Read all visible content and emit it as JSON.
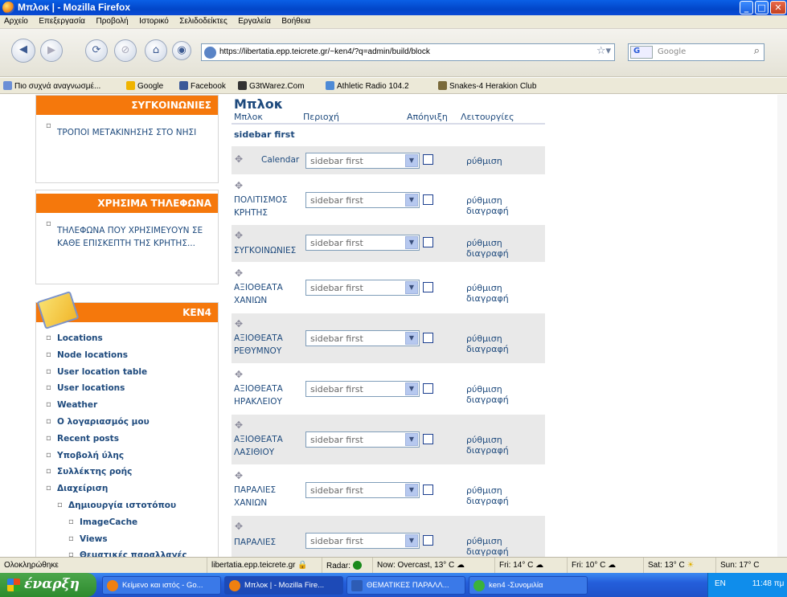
{
  "window": {
    "title": "Μπλοκ | - Mozilla Firefox"
  },
  "menu": [
    "Αρχείο",
    "Επεξεργασία",
    "Προβολή",
    "Ιστορικό",
    "Σελιδοδείκτες",
    "Εργαλεία",
    "Βοήθεια"
  ],
  "address": {
    "url": "https://libertatia.epp.teicrete.gr/~ken4/?q=admin/build/block"
  },
  "search": {
    "engine": "G",
    "placeholder": "Google"
  },
  "bookmarks": [
    "Πιο συχνά αναγνωσμέ...",
    "Google",
    "Facebook",
    "G3tWarez.Com",
    "Athletic Radio 104.2",
    "Snakes-4 Herakion Club"
  ],
  "sidebar": {
    "block1": {
      "title": "ΣΥΓΚΟΙΝΩΝΙΕΣ",
      "items": [
        "ΤΡΟΠΟΙ ΜΕΤΑΚΙΝΗΣΗΣ ΣΤΟ ΝΗΣΙ"
      ]
    },
    "block2": {
      "title": "ΧΡΗΣΙΜΑ ΤΗΛΕΦΩΝΑ",
      "items": [
        "ΤΗΛΕΦΩΝΑ ΠΟΥ ΧΡΗΣΙΜΕΥΟΥΝ ΣΕ ΚΑΘΕ ΕΠΙΣΚΕΠΤΗ ΤΗΣ ΚΡΗΤΗΣ..."
      ]
    },
    "block3": {
      "title": "KEN4",
      "items": [
        "Locations",
        "Node locations",
        "User location table",
        "User locations",
        "Weather",
        "Ο λογαριασμός μου",
        "Recent posts",
        "Υποβολή ύλης",
        "Συλλέκτης ροής",
        "Διαχείριση",
        "Δημιουργία ιστοτόπου",
        "ImageCache",
        "Views",
        "Θεματικές παραλλαγές"
      ]
    }
  },
  "main": {
    "title": "Μπλοκ",
    "headers": {
      "block": "Μπλοκ",
      "region": "Περιοχή",
      "throttle": "Απόηνιξη",
      "ops": "Λειτουργίες"
    },
    "region_label": "sidebar first",
    "rows": [
      {
        "name": "Calendar",
        "region": "sidebar first",
        "ops": "ρύθμιση"
      },
      {
        "name": "ΠΟΛΙΤΙΣΜΟΣ ΚΡΗΤΗΣ",
        "region": "sidebar first",
        "ops": "ρύθμιση διαγραφή"
      },
      {
        "name": "ΣΥΓΚΟΙΝΩΝΙΕΣ",
        "region": "sidebar first",
        "ops": "ρύθμιση διαγραφή"
      },
      {
        "name": "ΑΞΙΟΘΕΑΤΑ ΧΑΝΙΩΝ",
        "region": "sidebar first",
        "ops": "ρύθμιση διαγραφή"
      },
      {
        "name": "ΑΞΙΟΘΕΑΤΑ ΡΕΘΥΜΝΟΥ",
        "region": "sidebar first",
        "ops": "ρύθμιση διαγραφή"
      },
      {
        "name": "ΑΞΙΟΘΕΑΤΑ ΗΡΑΚΛΕΙΟΥ",
        "region": "sidebar first",
        "ops": "ρύθμιση διαγραφή"
      },
      {
        "name": "ΑΞΙΟΘΕΑΤΑ ΛΑΣΙΘΙΟΥ",
        "region": "sidebar first",
        "ops": "ρύθμιση διαγραφή"
      },
      {
        "name": "ΠΑΡΑΛΙΕΣ ΧΑΝΙΩΝ",
        "region": "sidebar first",
        "ops": "ρύθμιση διαγραφή"
      },
      {
        "name": "ΠΑΡΑΛΙΕΣ",
        "region": "sidebar first",
        "ops": "ρύθμιση διαγραφή"
      }
    ]
  },
  "status": {
    "text": "Ολοκληρώθηκε",
    "host": "libertatia.epp.teicrete.gr",
    "radar": "Radar:",
    "now": "Now: Overcast, 13° C",
    "f1": "Fri: 14° C",
    "f2": "Fri: 10° C",
    "f3": "Sat: 13° C",
    "f4": "Sun: 17° C"
  },
  "taskbar": {
    "start": "έναρξη",
    "tasks": [
      "Κείμενο και ιστός - Go...",
      "Μπλοκ | - Mozilla Fire...",
      "ΘΕΜΑΤΙΚΕΣ ΠΑΡΑΛΛ...",
      "ken4 -Συνομιλία"
    ],
    "lang": "EN",
    "clock": "11:48 πμ"
  }
}
